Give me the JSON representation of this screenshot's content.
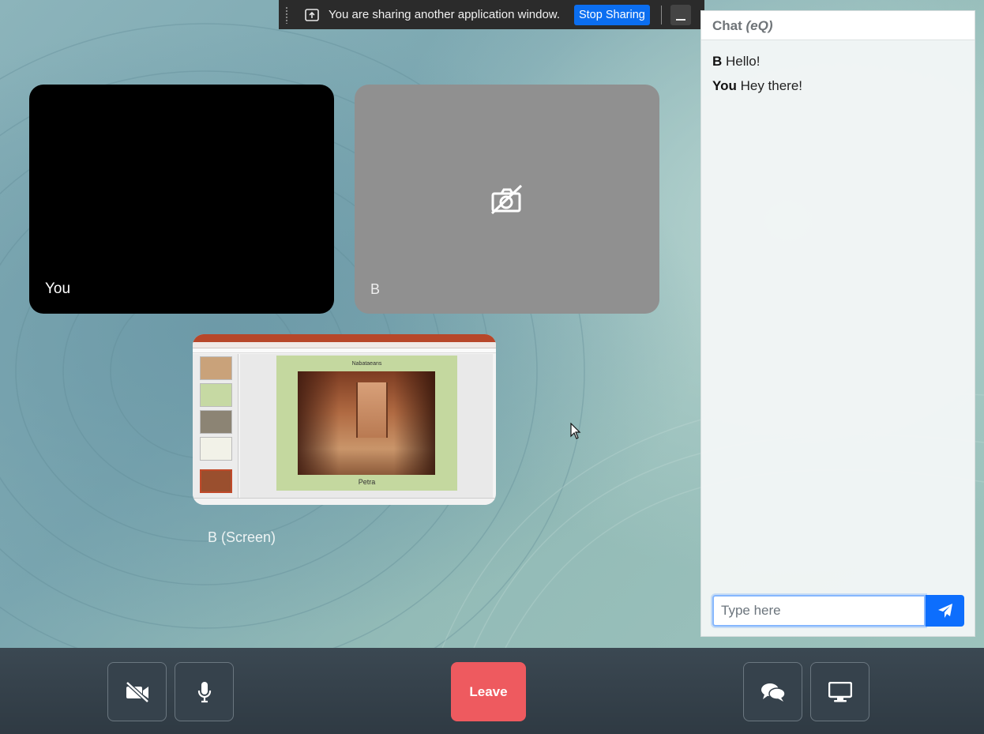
{
  "share_bar": {
    "message": "You are sharing another application window.",
    "stop_label": "Stop Sharing"
  },
  "tiles": {
    "you_label": "You",
    "b_label": "B",
    "screen_label": "B (Screen)"
  },
  "shared_slide": {
    "title": "Nabataeans",
    "caption": "Petra"
  },
  "chat": {
    "title": "Chat",
    "room": "(eQ)",
    "messages": [
      {
        "sender": "B",
        "text": "Hello!"
      },
      {
        "sender": "You",
        "text": "Hey there!"
      }
    ],
    "input_placeholder": "Type here"
  },
  "toolbar": {
    "leave_label": "Leave",
    "camera_icon": "video-slash-icon",
    "mic_icon": "microphone-icon",
    "chat_icon": "comments-icon",
    "screen_icon": "desktop-icon"
  },
  "colors": {
    "primary": "#0d6efd",
    "leave": "#ee5a5f",
    "stop_sharing": "#0b6ef0"
  }
}
